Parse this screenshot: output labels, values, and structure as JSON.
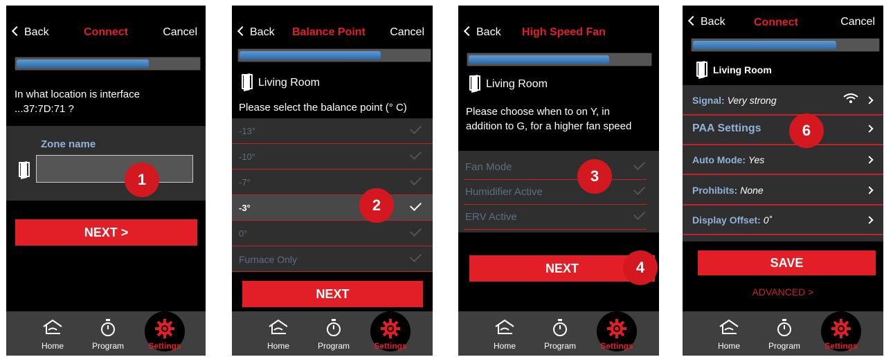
{
  "screen1": {
    "back": "Back",
    "title": "Connect",
    "cancel": "Cancel",
    "progress": 0.73,
    "prompt_line1": "In what location is interface",
    "prompt_line2": "...37:7D:71 ?",
    "zone_label": "Zone name",
    "zone_value": "",
    "badge": "1",
    "next": "NEXT >"
  },
  "screen2": {
    "back": "Back",
    "title": "Balance Point",
    "cancel": "Cancel",
    "progress": 0.75,
    "room": "Living Room",
    "prompt": "Please select the balance point (° C)",
    "options": [
      "-13°",
      "-10°",
      "-7°",
      "-3°",
      "0°",
      "Furnace Only"
    ],
    "selected_index": 3,
    "badge": "2",
    "next": "NEXT"
  },
  "screen3": {
    "back": "Back",
    "title": "High Speed Fan",
    "progress": 0.78,
    "room": "Living Room",
    "prompt_line1": "Please choose when to on Y, in",
    "prompt_line2": "addition to G, for a higher fan speed",
    "options": [
      "Fan Mode",
      "Humidifier Active",
      "ERV Active"
    ],
    "badge3": "3",
    "badge4": "4",
    "next": "NEXT"
  },
  "screen4": {
    "back": "Back",
    "title": "Connect",
    "cancel": "Cancel",
    "progress": 0.78,
    "room": "Living Room",
    "rows": [
      {
        "key": "Signal:",
        "value": "Very strong"
      },
      {
        "key": "PAA Settings",
        "value": ""
      },
      {
        "key": "Auto Mode:",
        "value": "Yes"
      },
      {
        "key": "Prohibits:",
        "value": "None"
      },
      {
        "key": "Display Offset:",
        "value": "0˚"
      }
    ],
    "badge": "6",
    "save": "SAVE",
    "advanced": "ADVANCED >"
  },
  "tabbar": {
    "home": "Home",
    "program": "Program",
    "settings": "Settings"
  },
  "colors": {
    "brand_red": "#e21f26",
    "progress_blue": "#3f7cc0",
    "row_label_blue": "#8fb3d9",
    "list_bg": "#2f2f2f",
    "tabbar_bg": "#3f3f3f"
  },
  "icons": [
    "chevron-left-icon",
    "door-icon",
    "checkmark-icon",
    "wifi-icon",
    "chevron-right-icon",
    "home-icon",
    "stopwatch-icon",
    "gear-icon"
  ]
}
